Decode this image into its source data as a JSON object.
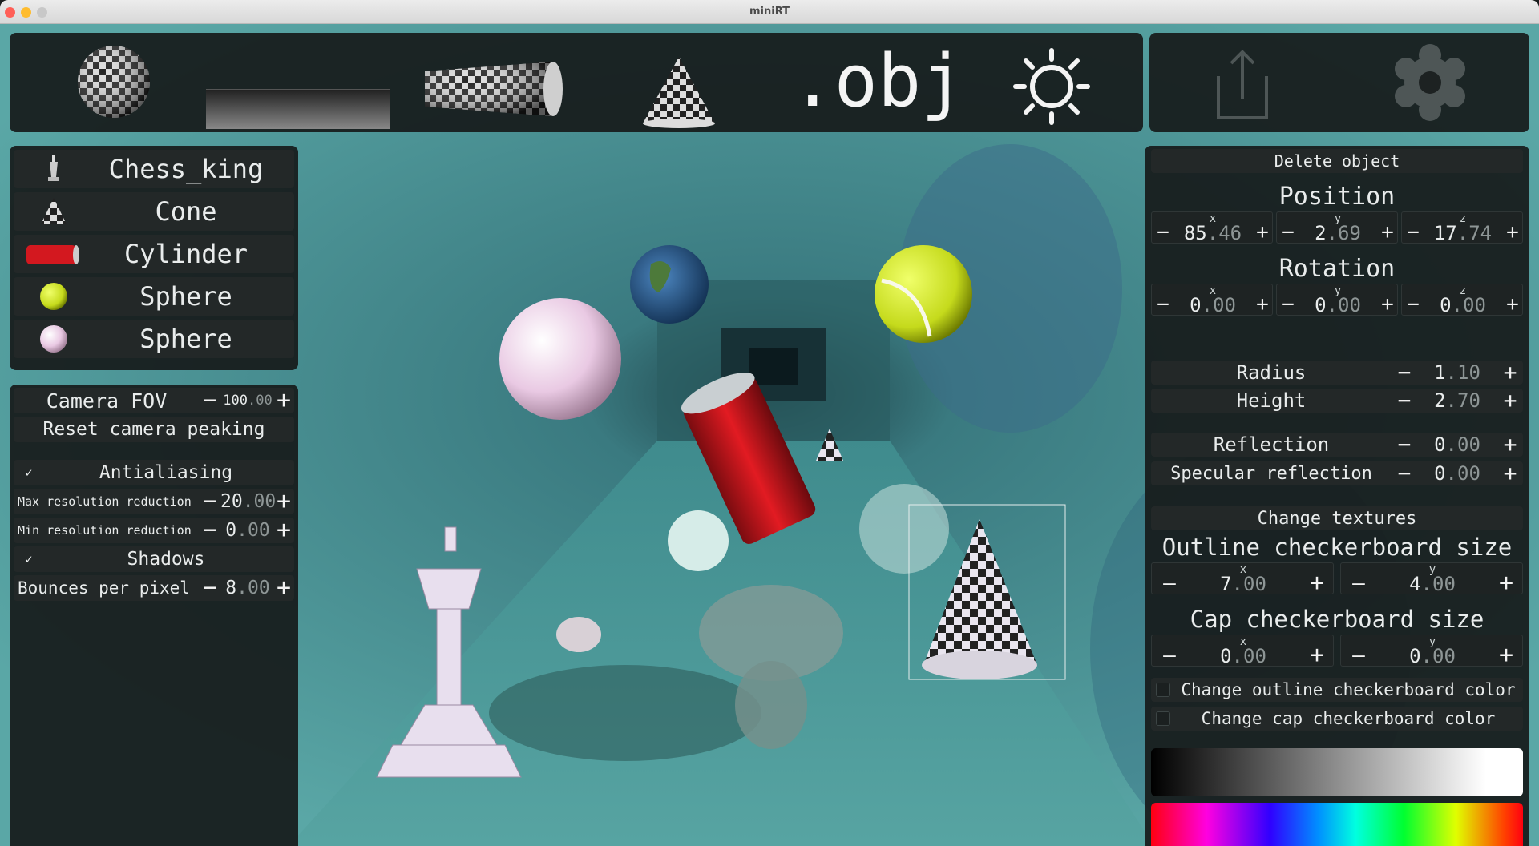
{
  "window": {
    "title": "miniRT",
    "traffic_colors": [
      "#ff5f57",
      "#febc2e",
      "#28c840"
    ]
  },
  "toolbar": {
    "items": [
      {
        "name": "sphere",
        "icon": "checker-sphere-icon"
      },
      {
        "name": "plane",
        "icon": "plane-gradient-icon"
      },
      {
        "name": "cylinder",
        "icon": "checker-cylinder-icon"
      },
      {
        "name": "cone",
        "icon": "checker-cone-icon"
      },
      {
        "name": "obj",
        "label": ".obj"
      },
      {
        "name": "light",
        "icon": "sun-icon"
      }
    ],
    "export_icon": "export-icon",
    "settings_icon": "gear-icon"
  },
  "objects": [
    {
      "label": "Chess_king",
      "icon": "chess-king-thumb"
    },
    {
      "label": "Cone",
      "icon": "checker-cone-thumb"
    },
    {
      "label": "Cylinder",
      "icon": "coke-can-thumb"
    },
    {
      "label": "Sphere",
      "icon": "tennis-ball-thumb"
    },
    {
      "label": "Sphere",
      "icon": "baseball-thumb"
    }
  ],
  "camera": {
    "fov_label": "Camera FOV",
    "fov_int": "100",
    "fov_dec": ".00",
    "reset_label": "Reset camera peaking",
    "antialiasing_label": "Antialiasing",
    "antialiasing_checked": true,
    "max_res_label": "Max resolution reduction",
    "max_res_int": "20",
    "max_res_dec": ".00",
    "min_res_label": "Min resolution reduction",
    "min_res_int": "0",
    "min_res_dec": ".00",
    "shadows_label": "Shadows",
    "shadows_checked": true,
    "bounces_label": "Bounces per pixel",
    "bounces_int": "8",
    "bounces_dec": ".00"
  },
  "props": {
    "delete_label": "Delete object",
    "position": {
      "title": "Position",
      "x_int": "85",
      "x_dec": ".46",
      "y_int": "2",
      "y_dec": ".69",
      "z_int": "17",
      "z_dec": ".74"
    },
    "rotation": {
      "title": "Rotation",
      "x_int": "0",
      "x_dec": ".00",
      "y_int": "0",
      "y_dec": ".00",
      "z_int": "0",
      "z_dec": ".00"
    },
    "axes": {
      "x": "x",
      "y": "y",
      "z": "z"
    },
    "radius": {
      "label": "Radius",
      "int": "1",
      "dec": ".10"
    },
    "height": {
      "label": "Height",
      "int": "2",
      "dec": ".70"
    },
    "reflection": {
      "label": "Reflection",
      "int": "0",
      "dec": ".00"
    },
    "specular": {
      "label": "Specular reflection",
      "int": "0",
      "dec": ".00"
    },
    "change_textures_label": "Change textures",
    "outline_checker": {
      "title": "Outline checkerboard size",
      "x_int": "7",
      "x_dec": ".00",
      "y_int": "4",
      "y_dec": ".00"
    },
    "cap_checker": {
      "title": "Cap checkerboard size",
      "x_int": "0",
      "x_dec": ".00",
      "y_int": "0",
      "y_dec": ".00"
    },
    "outline_color_label": "Change outline checkerboard color",
    "cap_color_label": "Change cap checkerboard color"
  }
}
